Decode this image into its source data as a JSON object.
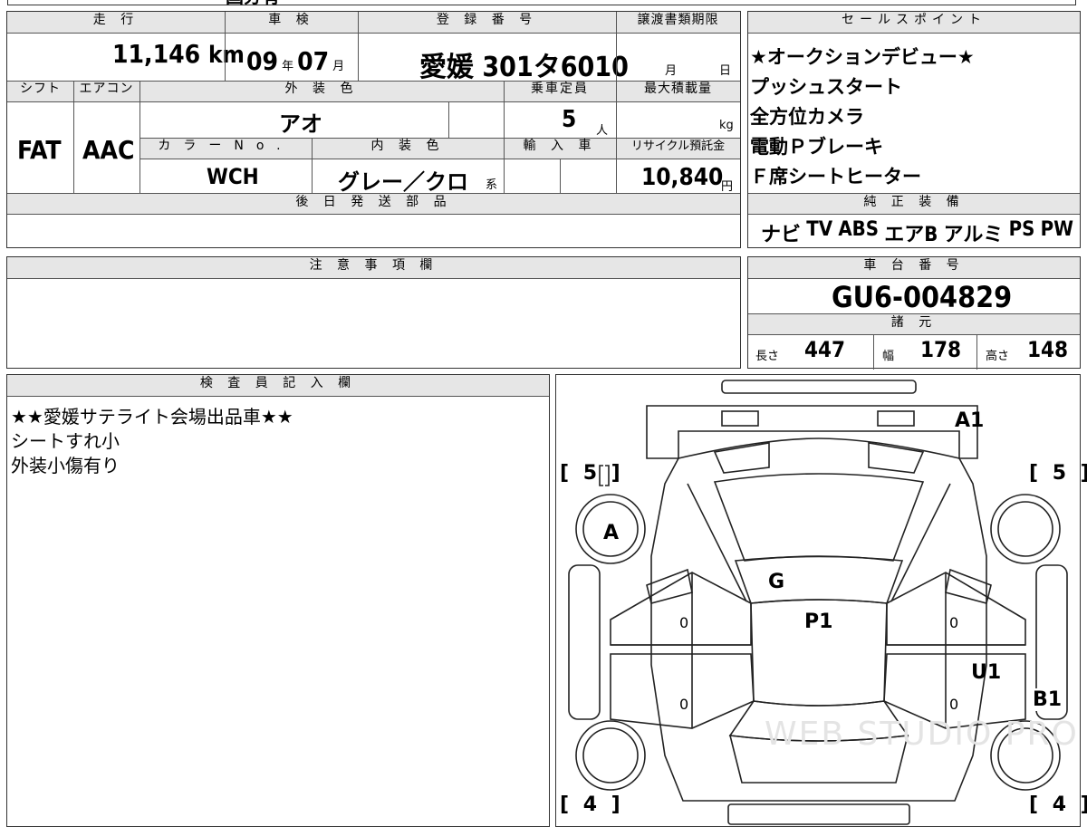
{
  "top_strip": {
    "partial_text": "国分有"
  },
  "headers": {
    "mileage": "走 行",
    "inspection": "車 検",
    "registration": "登 録 番 号",
    "transfer_deadline": "譲渡書類期限",
    "sales_points": "セールスポイント",
    "shift": "シフト",
    "aircon": "エアコン",
    "exterior_color": "外 装 色",
    "capacity": "乗車定員",
    "max_load": "最大積載量",
    "color_no": "カラーNo.",
    "interior_color": "内 装 色",
    "import": "輸 入 車",
    "recycle_fee": "リサイクル預託金",
    "later_parts": "後 日 発 送 部 品",
    "genuine_equipment": "純 正 装 備",
    "notes": "注 意 事 項 欄",
    "chassis_number": "車 台 番 号",
    "specs": "諸 元",
    "inspector": "検 査 員 記 入 欄"
  },
  "mileage": {
    "value": "11,146",
    "unit": "km"
  },
  "inspection": {
    "year": "09",
    "year_unit": "年",
    "month": "07",
    "month_unit": "月"
  },
  "registration": {
    "value": "愛媛 301タ6010"
  },
  "transfer_deadline": {
    "month_unit": "月",
    "day_unit": "日"
  },
  "shift": "FAT",
  "aircon": "AAC",
  "exterior_color": "アオ",
  "capacity": {
    "value": "5",
    "unit": "人"
  },
  "max_load": {
    "unit": "kg"
  },
  "color_no": "WCH",
  "interior_color": {
    "value": "グレー／クロ",
    "suffix": "系"
  },
  "recycle_fee": {
    "value": "10,840",
    "unit": "円"
  },
  "sales_points": [
    "★オークションデビュー★",
    "プッシュスタート",
    "全方位カメラ",
    "電動Ｐブレーキ",
    "Ｆ席シートヒーター"
  ],
  "genuine_equipment": [
    "ナビ",
    "TV",
    "ABS",
    "エアB",
    "アルミ",
    "PS",
    "PW"
  ],
  "chassis_number": "GU6-004829",
  "specs": {
    "length_label": "長さ",
    "length": "447",
    "width_label": "幅",
    "width": "178",
    "height_label": "高さ",
    "height": "148"
  },
  "inspector_notes": [
    "★★愛媛サテライト会場出品車★★",
    "シートすれ小",
    "外装小傷有り"
  ],
  "diagram": {
    "tire_front_left": "[ 5 ]",
    "tire_front_right": "[ 5 ]",
    "tire_rear_left": "[ 4 ]",
    "tire_rear_right": "[ 4 ]",
    "marks": [
      "A1",
      "A",
      "G",
      "P1",
      "U1",
      "B1"
    ],
    "door_marks": [
      "0",
      "0",
      "0",
      "0"
    ],
    "watermark": "WEB STUDIO PRO"
  }
}
